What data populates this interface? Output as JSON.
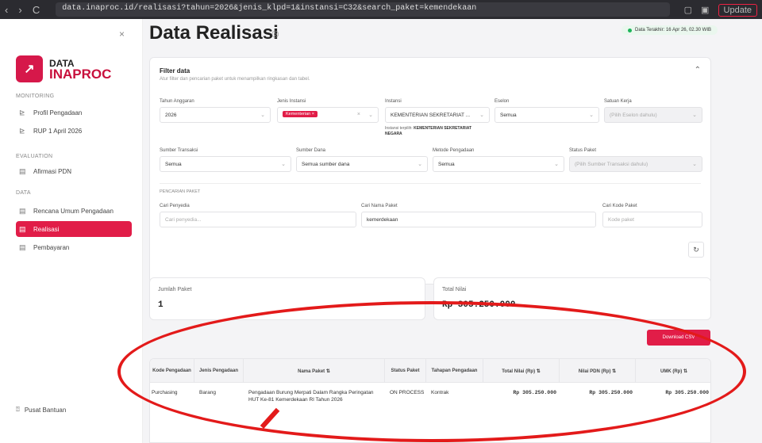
{
  "browser": {
    "nav": [
      "‹",
      "›",
      "C"
    ],
    "url": "data.inaproc.id/realisasi?tahun=2026&jenis_klpd=1&instansi=C32&search_paket=kemendekaan",
    "update_label": "Update"
  },
  "sidebar": {
    "collapse_icon": "×",
    "logo_top": "DATA",
    "logo_bottom": "INAPROC",
    "sections": {
      "monitoring": "MONITORING",
      "evaluation": "EVALUATION",
      "data": "DATA"
    },
    "items": [
      {
        "label": "Profil Pengadaan",
        "icon": "chart-icon"
      },
      {
        "label": "RUP 1 April 2026",
        "icon": "chart-icon"
      },
      {
        "label": "Afirmasi PDN",
        "icon": "calendar-icon"
      },
      {
        "label": "Rencana Umum Pengadaan",
        "icon": "calendar-icon"
      },
      {
        "label": "Realisasi",
        "icon": "calendar-icon"
      },
      {
        "label": "Pembayaran",
        "icon": "calendar-icon"
      }
    ],
    "help": "Pusat Bantuan"
  },
  "page": {
    "title": "Data Realisasi",
    "updated": "Data Terakhir: 16 Apr 26, 02.30 WIB",
    "accent": "#e11d48"
  },
  "filter": {
    "title": "Filter data",
    "subtitle": "Atur filter dan pencarian paket untuk menampilkan ringkasan dan tabel.",
    "labels": {
      "tahun": "Tahun Anggaran",
      "jenis": "Jenis Instansi",
      "instansi": "Instansi",
      "eselon": "Eselon",
      "satker": "Satuan Kerja",
      "sumber_transaksi": "Sumber Transaksi",
      "sumber_dana": "Sumber Dana",
      "metode": "Metode Pengadaan",
      "status": "Status Paket",
      "pencarian": "PENCARIAN PAKET",
      "cari_penyedia": "Cari Penyedia",
      "cari_nama": "Cari Nama Paket",
      "cari_kode": "Cari Kode Paket"
    },
    "values": {
      "tahun": "2026",
      "jenis_chip": "Kementerian ×",
      "instansi": "KEMENTERIAN SEKRETARIAT ...",
      "eselon": "Semua",
      "satker": "(Pilih Eselon dahulu)",
      "sumber_transaksi": "Semua",
      "sumber_dana": "Semua sumber dana",
      "metode": "Semua",
      "status": "(Pilih Sumber Transaksi dahulu)",
      "cari_penyedia": "Cari penyedia...",
      "cari_nama": "kemerdekaan",
      "cari_kode": "Kode paket"
    },
    "note_prefix": "Instansi terpilih:",
    "note_value": "KEMENTERIAN SEKRETARIAT NEGARA"
  },
  "stats": {
    "jumlah_label": "Jumlah Paket",
    "jumlah_value": "1",
    "total_label": "Total Nilai",
    "total_value": "Rp 305.250.000"
  },
  "download_label": "Download CSV",
  "table": {
    "headers": [
      "Kode Pengadaan",
      "Jenis Pengadaan",
      "Nama Paket ⇅",
      "Status Paket",
      "Tahapan Pengadaan",
      "Total Nilai (Rp) ⇅",
      "Nilai PDN (Rp) ⇅",
      "UMK (Rp) ⇅"
    ],
    "row": {
      "kode": "Purchasing",
      "jenis": "Barang",
      "nama": "Pengadaan Burung Merpati Dalam Rangka Peringatan HUT Ke-81 Kemerdekaan RI Tahun 2026",
      "status": "ON PROCESS",
      "tahapan": "Kontrak",
      "total": "Rp 305.250.000",
      "pdn": "Rp 305.250.000",
      "umk": "Rp 305.250.000"
    }
  },
  "annotation_color": "#e31a1a"
}
